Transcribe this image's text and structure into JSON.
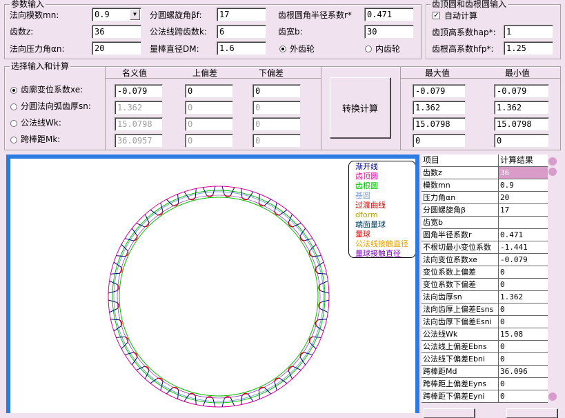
{
  "params_group": {
    "title": "参数输入",
    "normal_module_label": "法向模数mn:",
    "normal_module_value": "0.9",
    "teeth_label": "齿数z:",
    "teeth_value": "36",
    "pressure_angle_label": "法向压力角αn:",
    "pressure_angle_value": "20",
    "helix_angle_label": "分圆螺旋角βf:",
    "helix_angle_value": "17",
    "span_teeth_label": "公法线跨齿数k:",
    "span_teeth_value": "6",
    "pin_dia_label": "量棒直径DM:",
    "pin_dia_value": "1.6",
    "root_radius_label": "齿根圆角半径系数r*",
    "root_radius_value": "0.471",
    "face_width_label": "齿宽b:",
    "face_width_value": "30",
    "external_label": "外齿轮",
    "internal_label": "内齿轮"
  },
  "tip_root_group": {
    "title": "齿顶圆和齿根圆输入",
    "auto_calc_label": "自动计算",
    "hap_label": "齿顶高系数hap*:",
    "hap_value": "1",
    "hfp_label": "齿根高系数hfp*:",
    "hfp_value": "1.25"
  },
  "select_group": {
    "title": "选择输入和计算",
    "col_nominal": "名义值",
    "col_upper": "上偏差",
    "col_lower": "下偏差",
    "rows": [
      {
        "label": "齿廓变位系数xe:",
        "nominal": "-0.079",
        "upper": "0",
        "lower": "0"
      },
      {
        "label": "分圆法向弧齿厚sn:",
        "nominal": "1.362",
        "upper": "0",
        "lower": "0"
      },
      {
        "label": "公法线Wk:",
        "nominal": "15.0798",
        "upper": "0",
        "lower": "0"
      },
      {
        "label": "跨棒距Mk:",
        "nominal": "36.0957",
        "upper": "0",
        "lower": "0"
      }
    ],
    "convert_button": "转换计算",
    "col_max": "最大值",
    "col_min": "最小值",
    "max_values": [
      "-0.079",
      "1.362",
      "15.0798",
      "0"
    ],
    "min_values": [
      "-0.079",
      "1.362",
      "15.0798",
      "0"
    ]
  },
  "legend": {
    "items": [
      {
        "text": "渐开线",
        "color": "#000080"
      },
      {
        "text": "齿顶圆",
        "color": "#e0009a"
      },
      {
        "text": "齿根圆",
        "color": "#00c000"
      },
      {
        "text": "基圆",
        "color": "#7f9fd0"
      },
      {
        "text": "过渡曲线",
        "color": "#d00000"
      },
      {
        "text": "dform",
        "color": "#b0a000"
      },
      {
        "text": "端面量球",
        "color": "#004060"
      },
      {
        "text": "量球",
        "color": "#e00000"
      },
      {
        "text": "公法线接触直径",
        "color": "#e0a000"
      },
      {
        "text": "量球接触直径",
        "color": "#8000c0"
      }
    ]
  },
  "results": {
    "header_item": "项目",
    "header_result": "计算结果",
    "rows": [
      {
        "item": "齿数z",
        "value": "36",
        "selected": true
      },
      {
        "item": "模数mn",
        "value": "0.9"
      },
      {
        "item": "压力角αn",
        "value": "20"
      },
      {
        "item": "分圆螺旋角β",
        "value": "17"
      },
      {
        "item": "齿宽b",
        "value": ""
      },
      {
        "item": "圆角半径系数r",
        "value": "0.471"
      },
      {
        "item": "不根切最小变位系数",
        "value": "-1.441"
      },
      {
        "item": "法向变位系数xe",
        "value": "-0.079"
      },
      {
        "item": "变位系数上偏差",
        "value": "0"
      },
      {
        "item": "变位系数下偏差",
        "value": "0"
      },
      {
        "item": "法向齿厚sn",
        "value": "1.362"
      },
      {
        "item": "法向齿厚上偏差Esns",
        "value": "0"
      },
      {
        "item": "法向齿厚下偏差Esni",
        "value": "0"
      },
      {
        "item": "公法线Wk",
        "value": "15.08"
      },
      {
        "item": "公法线上偏差Ebns",
        "value": "0"
      },
      {
        "item": "公法线下偏差Ebni",
        "value": "0"
      },
      {
        "item": "跨棒距Md",
        "value": "36.096"
      },
      {
        "item": "跨棒距上偏差Eyns",
        "value": "0"
      },
      {
        "item": "跨棒距下偏差Eyni",
        "value": "0"
      }
    ]
  },
  "gear": {
    "teeth": 36
  }
}
